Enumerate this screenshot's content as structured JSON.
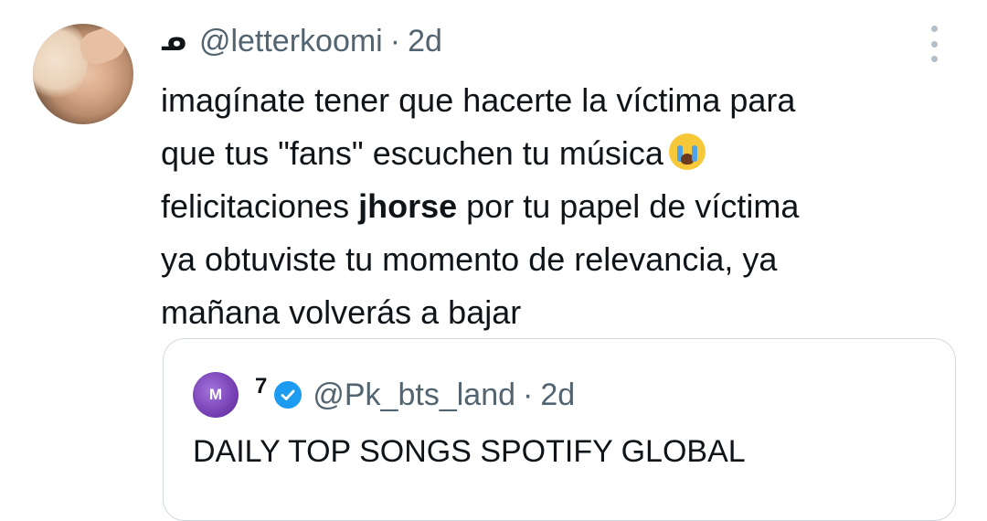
{
  "tweet": {
    "handle": "@letterkoomi",
    "separator": "·",
    "time": "2d",
    "name_glyph": "ᓄ",
    "body": {
      "line1": "imagínate tener que hacerte la víctima para",
      "line2": "que tus \"fans\" escuchen tu música",
      "line3_pre": "felicitaciones ",
      "line3_bold": "jhorse",
      "line3_post": " por tu papel de víctima",
      "line4": "ya obtuviste tu momento de relevancia, ya",
      "line5": "mañana volverás a bajar"
    },
    "emoji": "loudly-crying-face-icon"
  },
  "quote": {
    "avatar_text": "M",
    "name": "7",
    "verified": true,
    "handle": "@Pk_bts_land",
    "separator": "·",
    "time": "2d",
    "text": "DAILY TOP SONGS SPOTIFY GLOBAL"
  },
  "colors": {
    "text": "#0f1419",
    "secondary": "#536471",
    "verified": "#1d9bf0",
    "border": "#cfd9de"
  }
}
